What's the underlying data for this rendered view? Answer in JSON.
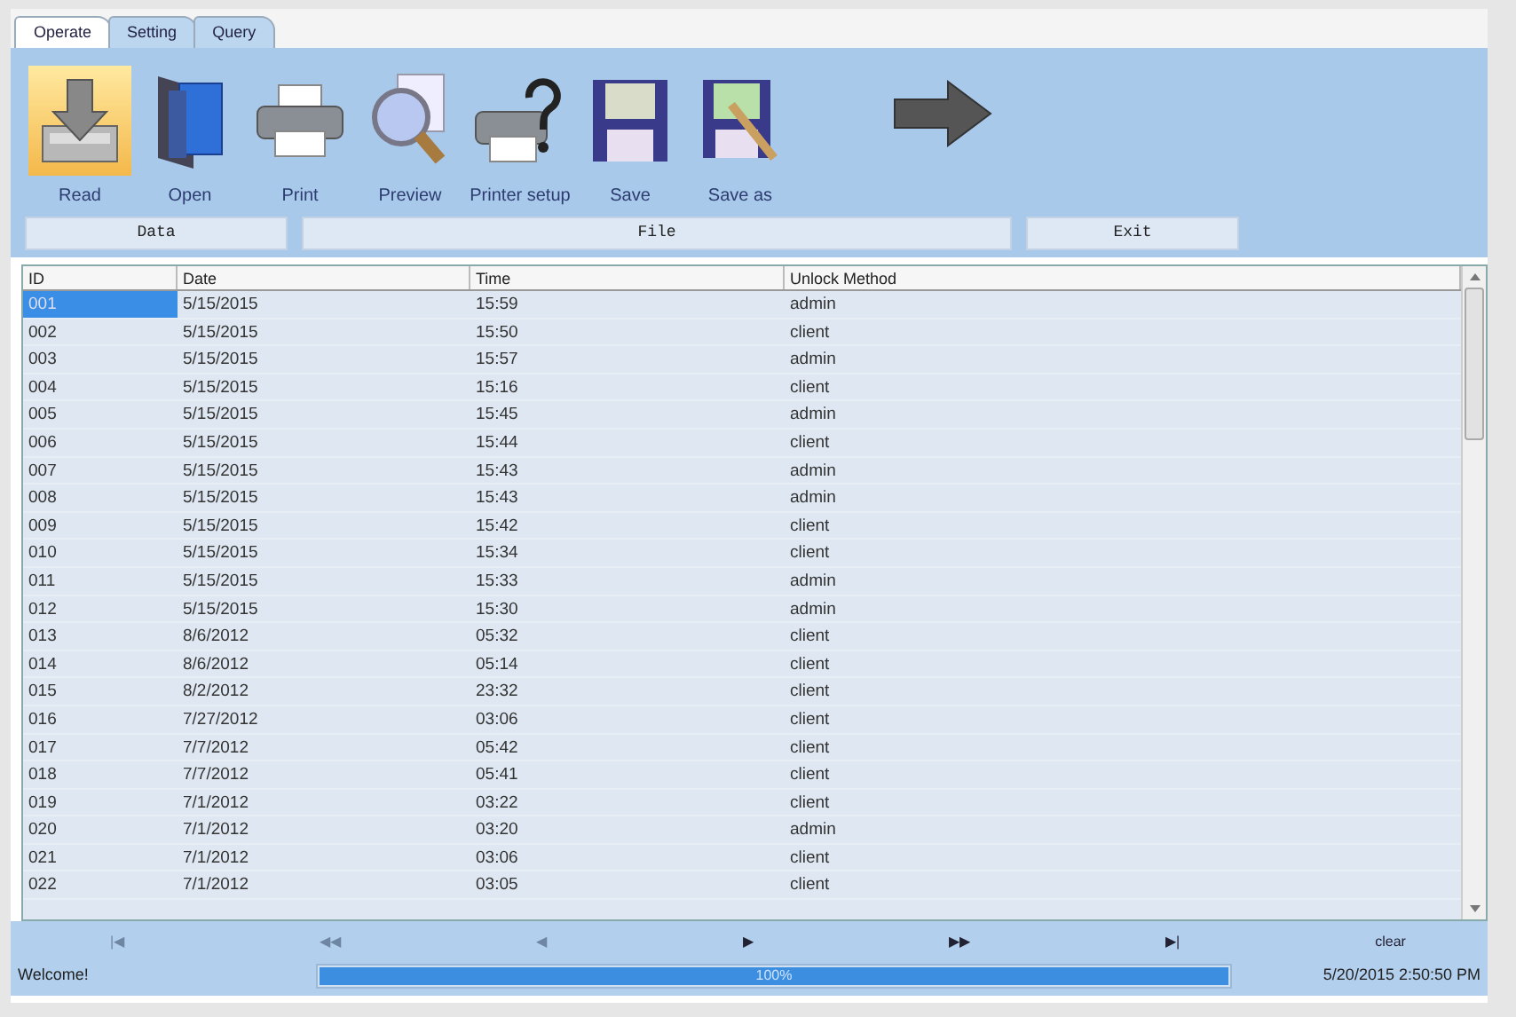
{
  "tabs": [
    {
      "label": "Operate",
      "selected": true
    },
    {
      "label": "Setting",
      "selected": false
    },
    {
      "label": "Query",
      "selected": false
    }
  ],
  "toolbar": [
    {
      "label": "Read",
      "selected": true
    },
    {
      "label": "Open",
      "selected": false
    },
    {
      "label": "Print",
      "selected": false
    },
    {
      "label": "Preview",
      "selected": false
    },
    {
      "label": "Printer setup",
      "selected": false
    },
    {
      "label": "Save",
      "selected": false
    },
    {
      "label": "Save as",
      "selected": false
    }
  ],
  "groups": [
    "Data",
    "File",
    "Exit"
  ],
  "table": {
    "columns": [
      "ID",
      "Date",
      "Time",
      "Unlock Method"
    ],
    "rows": [
      {
        "cells": [
          "001",
          "5/15/2015",
          "15:59",
          "admin"
        ],
        "selected": true
      },
      {
        "cells": [
          "002",
          "5/15/2015",
          "15:50",
          "client"
        ],
        "selected": false
      },
      {
        "cells": [
          "003",
          "5/15/2015",
          "15:57",
          "admin"
        ],
        "selected": false
      },
      {
        "cells": [
          "004",
          "5/15/2015",
          "15:16",
          "client"
        ],
        "selected": false
      },
      {
        "cells": [
          "005",
          "5/15/2015",
          "15:45",
          "admin"
        ],
        "selected": false
      },
      {
        "cells": [
          "006",
          "5/15/2015",
          "15:44",
          "client"
        ],
        "selected": false
      },
      {
        "cells": [
          "007",
          "5/15/2015",
          "15:43",
          "admin"
        ],
        "selected": false
      },
      {
        "cells": [
          "008",
          "5/15/2015",
          "15:43",
          "admin"
        ],
        "selected": false
      },
      {
        "cells": [
          "009",
          "5/15/2015",
          "15:42",
          "client"
        ],
        "selected": false
      },
      {
        "cells": [
          "010",
          "5/15/2015",
          "15:34",
          "client"
        ],
        "selected": false
      },
      {
        "cells": [
          "011",
          "5/15/2015",
          "15:33",
          "admin"
        ],
        "selected": false
      },
      {
        "cells": [
          "012",
          "5/15/2015",
          "15:30",
          "admin"
        ],
        "selected": false
      },
      {
        "cells": [
          "013",
          "8/6/2012",
          "05:32",
          "client"
        ],
        "selected": false
      },
      {
        "cells": [
          "014",
          "8/6/2012",
          "05:14",
          "client"
        ],
        "selected": false
      },
      {
        "cells": [
          "015",
          "8/2/2012",
          "23:32",
          "client"
        ],
        "selected": false
      },
      {
        "cells": [
          "016",
          "7/27/2012",
          "03:06",
          "client"
        ],
        "selected": false
      },
      {
        "cells": [
          "017",
          "7/7/2012",
          "05:42",
          "client"
        ],
        "selected": false
      },
      {
        "cells": [
          "018",
          "7/7/2012",
          "05:41",
          "client"
        ],
        "selected": false
      },
      {
        "cells": [
          "019",
          "7/1/2012",
          "03:22",
          "client"
        ],
        "selected": false
      },
      {
        "cells": [
          "020",
          "7/1/2012",
          "03:20",
          "admin"
        ],
        "selected": false
      },
      {
        "cells": [
          "021",
          "7/1/2012",
          "03:06",
          "client"
        ],
        "selected": false
      },
      {
        "cells": [
          "022",
          "7/1/2012",
          "03:05",
          "client"
        ],
        "selected": false
      }
    ]
  },
  "pager": [
    {
      "label": "|◀",
      "disabled": true
    },
    {
      "label": "◀◀",
      "disabled": true
    },
    {
      "label": "◀",
      "disabled": true
    },
    {
      "label": "▶",
      "disabled": false
    },
    {
      "label": "▶▶",
      "disabled": false
    },
    {
      "label": "▶|",
      "disabled": false
    },
    {
      "label": "clear",
      "disabled": false
    }
  ],
  "status_bar": {
    "message": "Welcome!",
    "progress": {
      "level": 1,
      "reading": "100%"
    },
    "datetime": "5/20/2015 2:50:50 PM"
  }
}
